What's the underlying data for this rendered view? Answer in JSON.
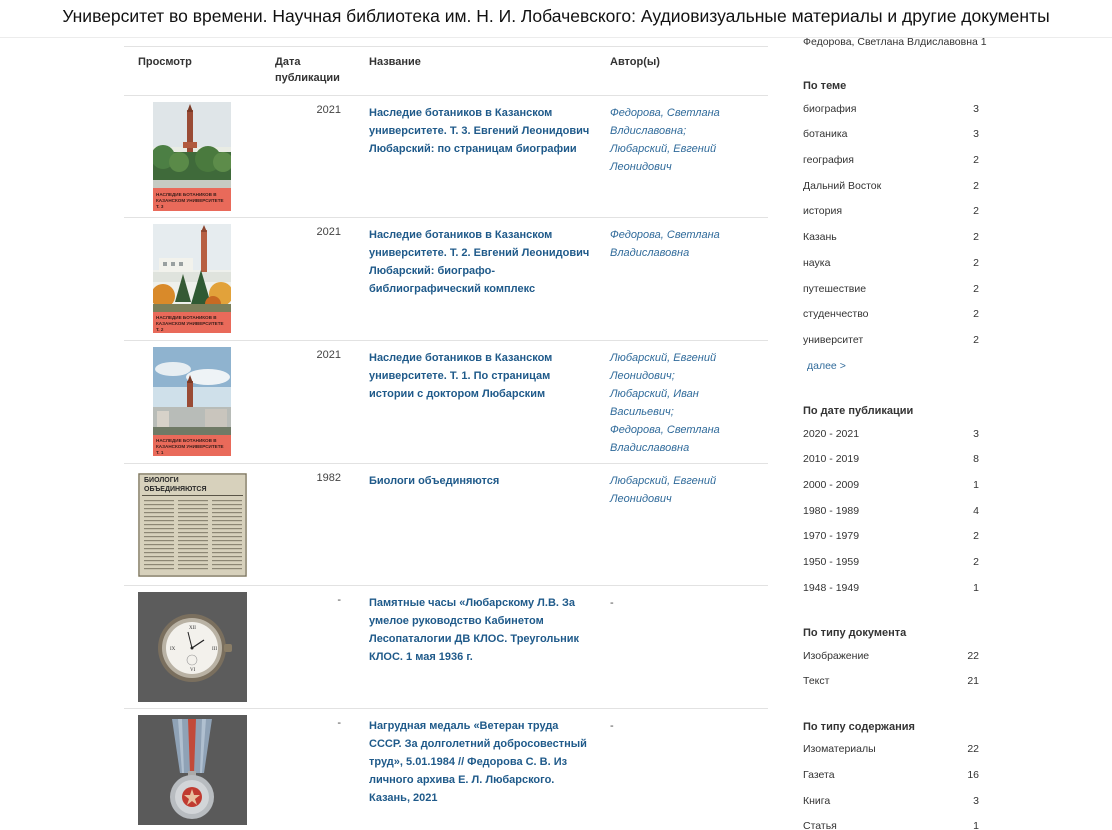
{
  "window": {
    "title": "Университет во времени. Научная библиотека им. Н. И. Лобачевского: Аудиовизуальные материалы и другие документы"
  },
  "table": {
    "headers": {
      "preview": "Просмотр",
      "date_line1": "Дата",
      "date_line2": "публикации",
      "title": "Название",
      "authors": "Автор(ы)"
    },
    "rows": [
      {
        "year": "2021",
        "title": "Наследие ботаников в Казанском университете. Т. 3. Евгений Леонидович Любарский: по страницам биографии",
        "authors": [
          "Федорова, Светлана Влдиславовна;",
          "Любарский, Евгений Леонидович"
        ],
        "cover_text": "НАСЛЕДИЕ БОТАНИКОВ В КАЗАНСКОМ УНИВЕРСИТЕТЕ Т. 3"
      },
      {
        "year": "2021",
        "title": "Наследие ботаников в Казанском университете. Т. 2. Евгений Леонидович Любарский: биографо-библиографический комплекс",
        "authors": [
          "Федорова, Светлана Владиславовна"
        ],
        "cover_text": "НАСЛЕДИЕ БОТАНИКОВ В КАЗАНСКОМ УНИВЕРСИТЕТЕ Т. 2"
      },
      {
        "year": "2021",
        "title": "Наследие ботаников в Казанском университете. Т. 1. По страницам истории с доктором Любарским",
        "authors": [
          "Любарский, Евгений Леонидович;",
          "Любарский, Иван Васильевич;",
          "Федорова, Светлана Владиславовна"
        ],
        "cover_text": "НАСЛЕДИЕ БОТАНИКОВ В КАЗАНСКОМ УНИВЕРСИТЕТЕ Т. 1"
      },
      {
        "year": "1982",
        "title": "Биологи объединяются",
        "authors": [
          "Любарский, Евгений Леонидович"
        ],
        "cover_text": "БИОЛОГИ ОБЪЕДИНЯЮТСЯ"
      },
      {
        "year": "-",
        "title": "Памятные часы «Любарскому Л.В. За умелое руководство Кабинетом Лесопаталогии ДВ КЛОС. Треугольник КЛОС. 1 мая 1936 г.",
        "authors_plain": "-"
      },
      {
        "year": "-",
        "title": "Нагрудная медаль «Ветеран труда СССР. За долголетний добросовестный труд», 5.01.1984 // Федорова С. В. Из личного архива Е. Л. Любарского. Казань, 2021",
        "authors_plain": "-"
      }
    ]
  },
  "sidebar": {
    "cut_item": "Федорова, Светлана Влдиславовна 1",
    "more_label": "далее >",
    "facets": {
      "subject": {
        "heading": "По теме",
        "items": [
          {
            "label": "биография",
            "count": "3"
          },
          {
            "label": "ботаника",
            "count": "3"
          },
          {
            "label": "география",
            "count": "2"
          },
          {
            "label": "Дальний Восток",
            "count": "2"
          },
          {
            "label": "история",
            "count": "2"
          },
          {
            "label": "Казань",
            "count": "2"
          },
          {
            "label": "наука",
            "count": "2"
          },
          {
            "label": "путешествие",
            "count": "2"
          },
          {
            "label": "студенчество",
            "count": "2"
          },
          {
            "label": "университет",
            "count": "2"
          }
        ]
      },
      "date": {
        "heading": "По дате публикации",
        "items": [
          {
            "label": "2020 - 2021",
            "count": "3"
          },
          {
            "label": "2010 - 2019",
            "count": "8"
          },
          {
            "label": "2000 - 2009",
            "count": "1"
          },
          {
            "label": "1980 - 1989",
            "count": "4"
          },
          {
            "label": "1970 - 1979",
            "count": "2"
          },
          {
            "label": "1950 - 1959",
            "count": "2"
          },
          {
            "label": "1948 - 1949",
            "count": "1"
          }
        ]
      },
      "doctype": {
        "heading": "По типу документа",
        "items": [
          {
            "label": "Изображение",
            "count": "22"
          },
          {
            "label": "Текст",
            "count": "21"
          }
        ]
      },
      "content": {
        "heading": "По типу содержания",
        "items": [
          {
            "label": "Изоматериалы",
            "count": "22"
          },
          {
            "label": "Газета",
            "count": "16"
          },
          {
            "label": "Книга",
            "count": "3"
          },
          {
            "label": "Статья",
            "count": "1"
          }
        ]
      }
    }
  },
  "colors": {
    "link": "#1f5a8a",
    "author_link": "#2f6a9a",
    "cover_band": "#e96a5a",
    "row_border": "#e2e2e2"
  }
}
